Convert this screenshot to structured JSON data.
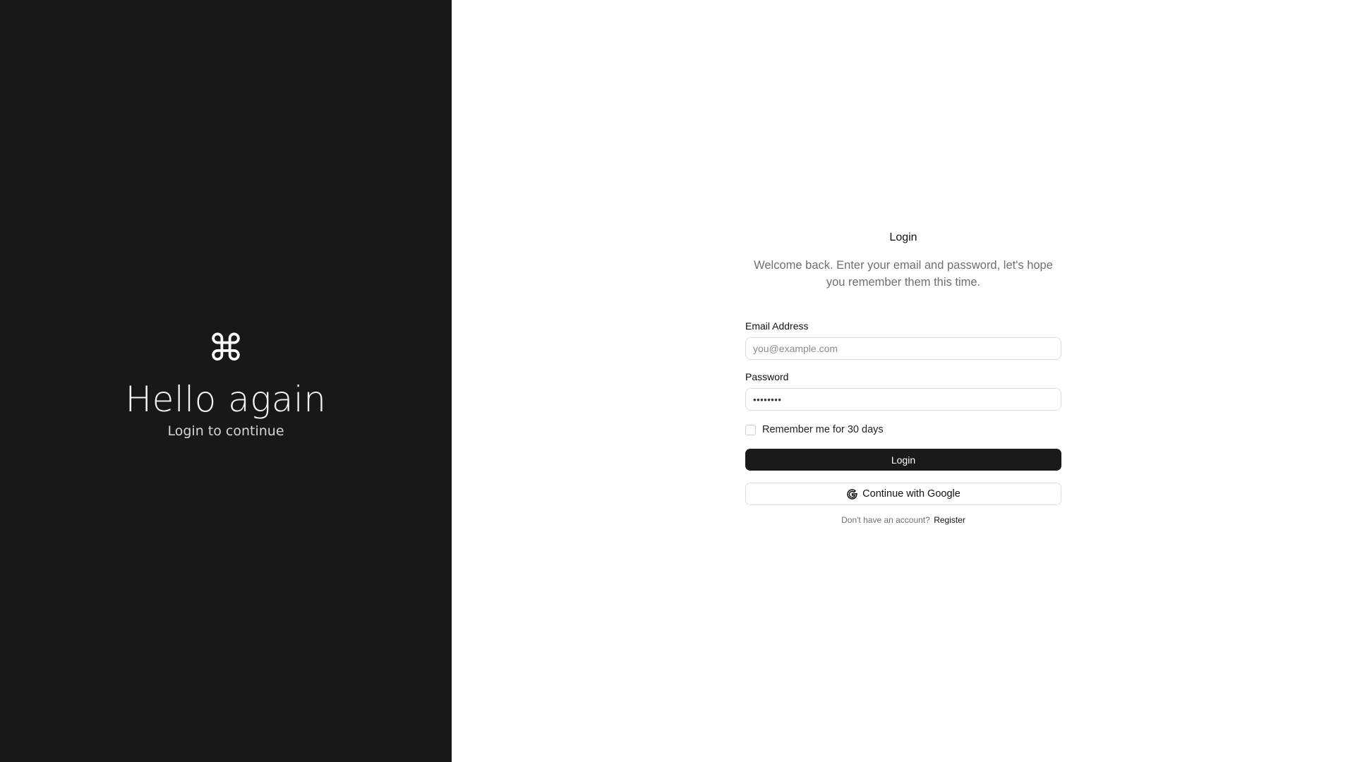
{
  "hero": {
    "icon": "⌘",
    "title": "Hello again",
    "subtitle": "Login to continue"
  },
  "form": {
    "title": "Login",
    "description": "Welcome back. Enter your email and password, let's hope you remember them this time.",
    "email": {
      "label": "Email Address",
      "placeholder": "you@example.com",
      "value": ""
    },
    "password": {
      "label": "Password",
      "value": "••••••••"
    },
    "remember": {
      "label": "Remember me for 30 days",
      "checked": false
    },
    "login_button": "Login",
    "google_button": "Continue with Google",
    "footer": {
      "prompt": "Don't have an account?",
      "link": "Register"
    }
  },
  "icons": {
    "hero": "command-key-icon",
    "google": "google-icon"
  },
  "colors": {
    "hero_background": "#181818",
    "primary_button": "#1a1a1a",
    "page_background": "#ffffff"
  }
}
